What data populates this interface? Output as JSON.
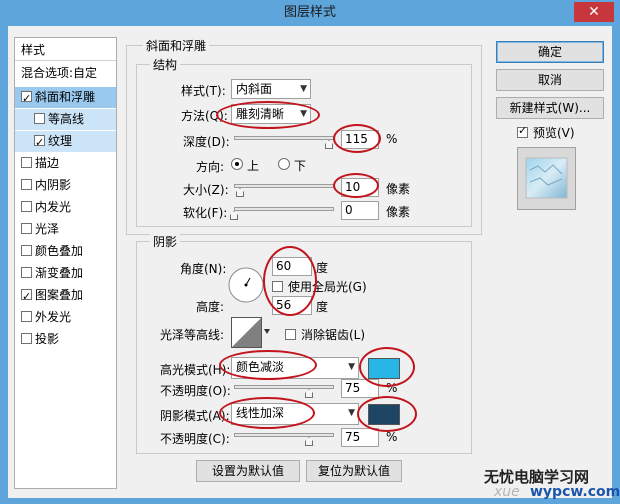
{
  "window": {
    "title": "图层样式",
    "close": "✕"
  },
  "styles_panel": {
    "header": "样式",
    "items": [
      {
        "label": "混合选项:自定",
        "checkbox": false
      },
      {
        "label": "斜面和浮雕",
        "checkbox": true,
        "checked": true
      },
      {
        "label": "等高线",
        "checkbox": true,
        "checked": false
      },
      {
        "label": "纹理",
        "checkbox": true,
        "checked": true
      },
      {
        "label": "描边",
        "checkbox": true,
        "checked": false
      },
      {
        "label": "内阴影",
        "checkbox": true,
        "checked": false
      },
      {
        "label": "内发光",
        "checkbox": true,
        "checked": false
      },
      {
        "label": "光泽",
        "checkbox": true,
        "checked": false
      },
      {
        "label": "颜色叠加",
        "checkbox": true,
        "checked": false
      },
      {
        "label": "渐变叠加",
        "checkbox": true,
        "checked": false
      },
      {
        "label": "图案叠加",
        "checkbox": true,
        "checked": true
      },
      {
        "label": "外发光",
        "checkbox": true,
        "checked": false
      },
      {
        "label": "投影",
        "checkbox": true,
        "checked": false
      }
    ]
  },
  "bevel": {
    "group_title": "斜面和浮雕",
    "structure_title": "结构",
    "style_label": "样式(T):",
    "style_value": "内斜面",
    "method_label": "方法(Q):",
    "method_value": "雕刻清晰",
    "depth_label": "深度(D):",
    "depth_value": "115",
    "depth_unit": "%",
    "depth_fraction": 0.95,
    "direction_label": "方向:",
    "direction_up": "上",
    "direction_down": "下",
    "size_label": "大小(Z):",
    "size_value": "10",
    "size_unit": "像素",
    "size_fraction": 0.06,
    "soften_label": "软化(F):",
    "soften_value": "0",
    "soften_unit": "像素",
    "soften_fraction": 0.0
  },
  "shading": {
    "title": "阴影",
    "angle_label": "角度(N):",
    "angle_value": "60",
    "degree": "度",
    "global_light_label": "使用全局光(G)",
    "altitude_label": "高度:",
    "altitude_value": "56",
    "gloss_label": "光泽等高线:",
    "anti_alias_label": "消除锯齿(L)",
    "highlight_label": "高光模式(H):",
    "highlight_mode": "颜色减淡",
    "highlight_color": "#28b6e6",
    "opacity_label1": "不透明度(O):",
    "opacity1_value": "75",
    "opacity1_fraction": 0.75,
    "shadow_label": "阴影模式(A):",
    "shadow_mode": "线性加深",
    "shadow_color": "#1c4663",
    "opacity_label2": "不透明度(C):",
    "opacity2_value": "75",
    "opacity2_fraction": 0.75,
    "percent": "%"
  },
  "buttons": {
    "ok": "确定",
    "cancel": "取消",
    "new_style": "新建样式(W)...",
    "preview": "预览(V)",
    "make_default": "设置为默认值",
    "reset_default": "复位为默认值"
  },
  "watermark": {
    "line1": "无忧电脑学习网",
    "line2": "wypcw.com",
    "faint": "xue"
  },
  "colors": {
    "accent_red": "#c2141c",
    "titlebar": "#5ea5dc",
    "selection": "#99c9ef"
  }
}
